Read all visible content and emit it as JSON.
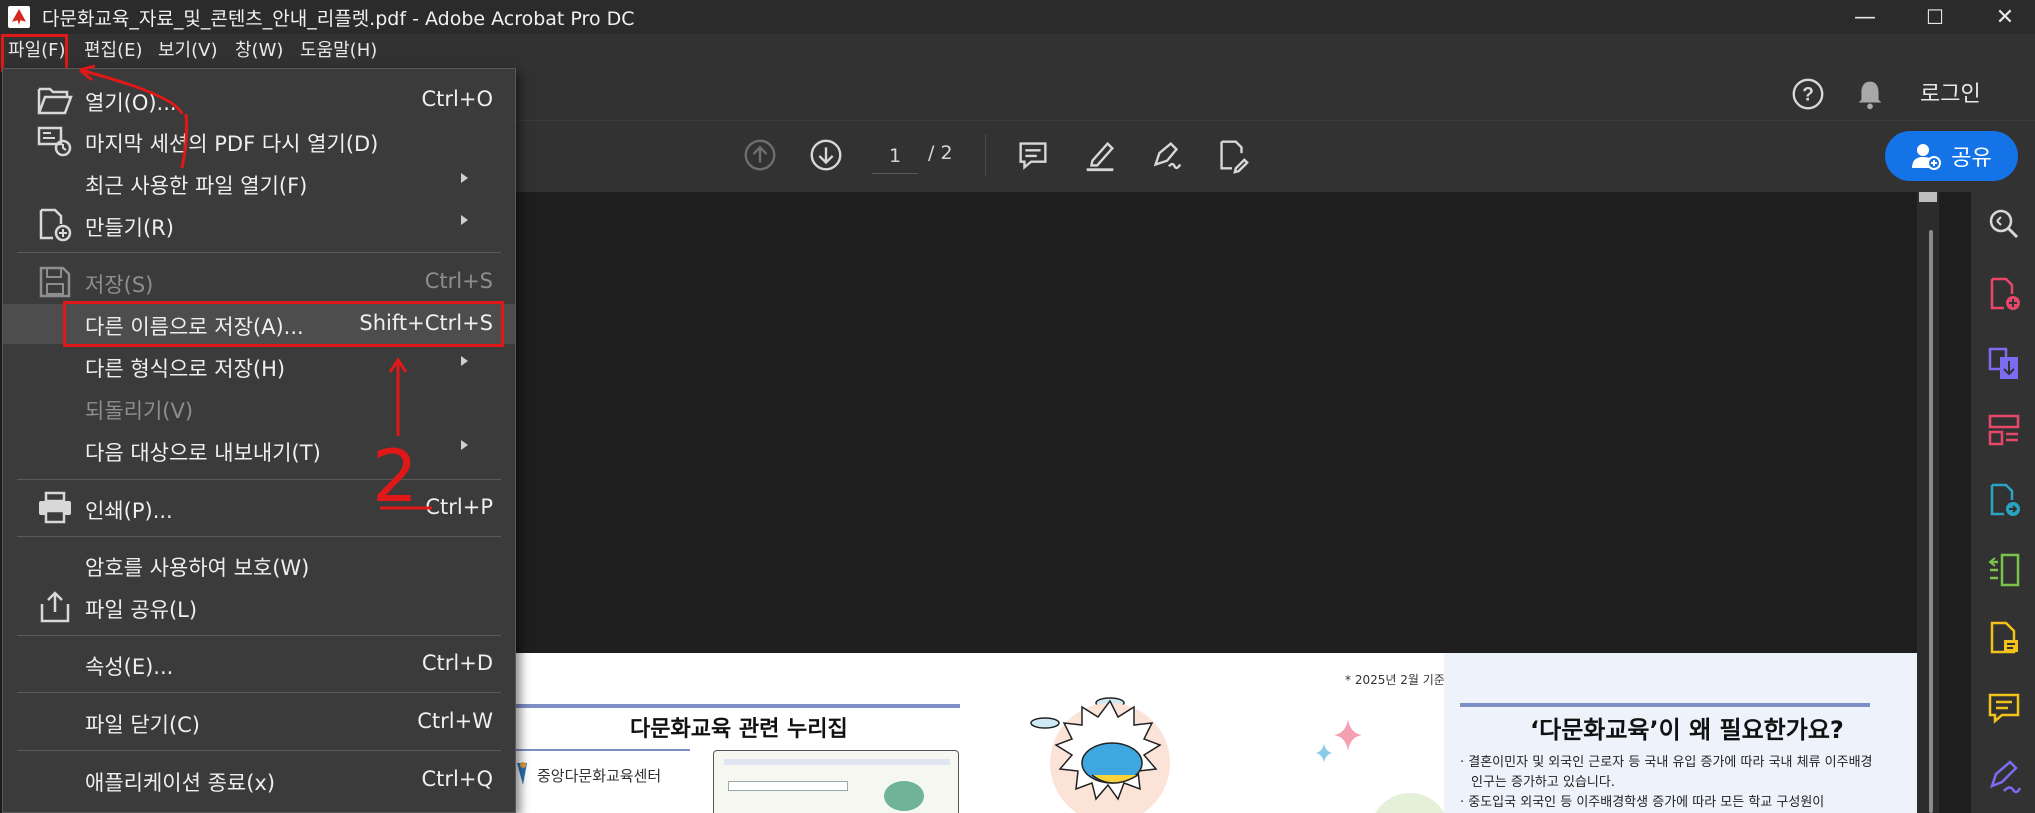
{
  "window": {
    "title": "다문화교육_자료_및_콘텐츠_안내_리플렛.pdf - Adobe Acrobat Pro DC",
    "minimize": "—",
    "maximize": "☐",
    "close": "✕"
  },
  "menubar": {
    "items": [
      "파일(F)",
      "편집(E)",
      "보기(V)",
      "창(W)",
      "도움말(H)"
    ]
  },
  "header": {
    "login": "로그인",
    "share": "공유"
  },
  "toolbar": {
    "page_current": "1",
    "page_total": "/ 2"
  },
  "file_menu": {
    "items": [
      {
        "label": "열기(O)...",
        "shortcut": "Ctrl+O"
      },
      {
        "label": "마지막 세션의 PDF 다시 열기(D)",
        "shortcut": ""
      },
      {
        "label": "최근 사용한 파일 열기(F)",
        "shortcut": ""
      },
      {
        "label": "만들기(R)",
        "shortcut": ""
      },
      {
        "label": "저장(S)",
        "shortcut": "Ctrl+S"
      },
      {
        "label": "다른 이름으로 저장(A)...",
        "shortcut": "Shift+Ctrl+S"
      },
      {
        "label": "다른 형식으로 저장(H)",
        "shortcut": ""
      },
      {
        "label": "되돌리기(V)",
        "shortcut": ""
      },
      {
        "label": "다음 대상으로 내보내기(T)",
        "shortcut": ""
      },
      {
        "label": "인쇄(P)...",
        "shortcut": "Ctrl+P"
      },
      {
        "label": "암호를 사용하여 보호(W)",
        "shortcut": ""
      },
      {
        "label": "파일 공유(L)",
        "shortcut": ""
      },
      {
        "label": "속성(E)...",
        "shortcut": "Ctrl+D"
      },
      {
        "label": "파일 닫기(C)",
        "shortcut": "Ctrl+W"
      },
      {
        "label": "애플리케이션 종료(x)",
        "shortcut": "Ctrl+Q"
      }
    ]
  },
  "annotation": {
    "step_number": "2"
  },
  "pdf_page": {
    "date_note": "* 2025년 2월 기준",
    "heading_left": "다문화교육 관련 누리집",
    "logo_text": "중앙다문화교육센터",
    "heading_right": "‘다문화교육’이 왜 필요한가요?",
    "bullet_1a": "· 결혼이민자 및 외국인 근로자 등 국내 유입 증가에 따라 국내 체류 이주배경",
    "bullet_1b": "인구는 증가하고 있습니다.",
    "bullet_2": "· 중도입국 외국인 등 이주배경학생 증가에 따라 모든 학교 구성원이"
  },
  "colors": {
    "accent_blue": "#1473e6",
    "annotation_red": "#e01818",
    "menu_bg": "#3b3b3b",
    "rail_icon_pink": "#e8476a",
    "rail_icon_purple": "#7b6cf0",
    "rail_icon_teal": "#29a4c4",
    "rail_icon_green": "#7cc34a",
    "rail_icon_yellow": "#f2c21b"
  }
}
